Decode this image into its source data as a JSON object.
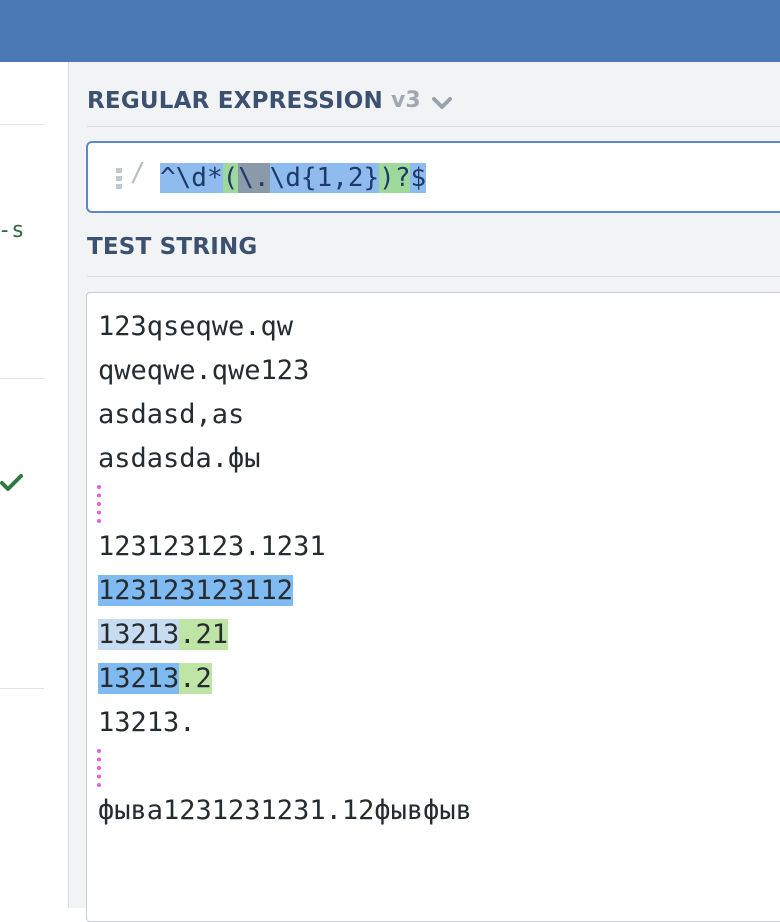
{
  "left_panel": {
    "flag_text": "-s"
  },
  "regex_section": {
    "title": "REGULAR EXPRESSION",
    "version": "v3",
    "delimiter": "/",
    "tokens": [
      "^",
      "\\d*",
      "(",
      "\\.",
      "\\d{1,2}",
      ")?",
      "$"
    ]
  },
  "test_section": {
    "title": "TEST STRING",
    "lines": [
      {
        "segments": [
          {
            "text": "123qseqwe.qw",
            "hl": "none"
          }
        ]
      },
      {
        "segments": [
          {
            "text": "qweqwe.qwe123",
            "hl": "none"
          }
        ]
      },
      {
        "segments": [
          {
            "text": "asdasd,as",
            "hl": "none"
          }
        ]
      },
      {
        "segments": [
          {
            "text": "asdasda.фы",
            "hl": "none"
          }
        ]
      },
      {
        "segments": [],
        "empty_match": true
      },
      {
        "segments": [
          {
            "text": "123123123.1231",
            "hl": "none"
          }
        ]
      },
      {
        "segments": [
          {
            "text": "123123123112",
            "hl": "full"
          }
        ]
      },
      {
        "segments": [
          {
            "text": "13213",
            "hl": "light"
          },
          {
            "text": ".21",
            "hl": "group"
          }
        ]
      },
      {
        "segments": [
          {
            "text": "13213",
            "hl": "full"
          },
          {
            "text": ".2",
            "hl": "group"
          }
        ]
      },
      {
        "segments": [
          {
            "text": "13213.",
            "hl": "none"
          }
        ]
      },
      {
        "segments": [],
        "empty_match": true
      },
      {
        "segments": [
          {
            "text": "фыва1231231231.12фывфыв",
            "hl": "none"
          }
        ]
      }
    ]
  },
  "colors": {
    "header": "#4a79b6",
    "match": "#7fbaf0",
    "match_alt": "#c7dcf1",
    "group": "#bfe5a6",
    "empty_match_marker": "#e65fe6",
    "title": "#3c5170"
  },
  "icons": [
    "grip-icon",
    "chevron-down-icon",
    "check-icon"
  ]
}
